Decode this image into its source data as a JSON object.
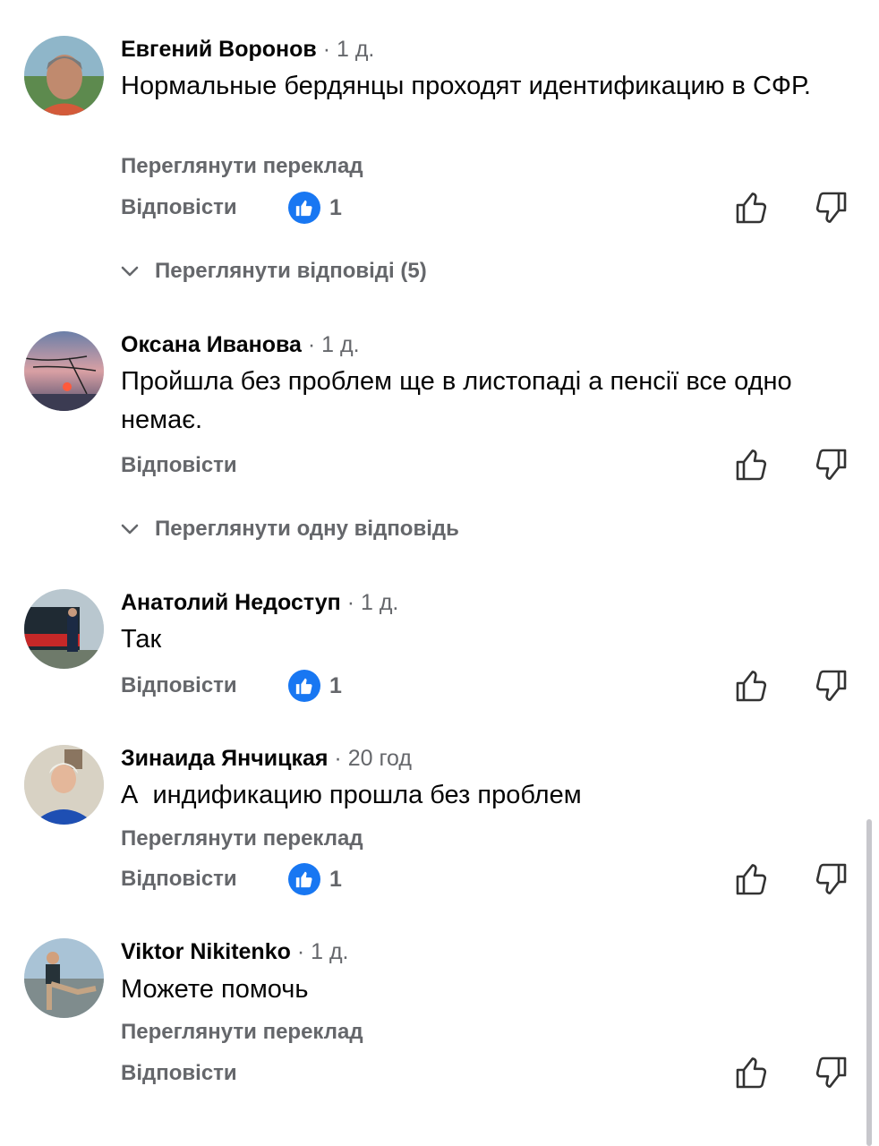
{
  "comments": [
    {
      "name": "Евгений Воронов",
      "time": "1 д.",
      "text": "Нормальные бердянцы проходят идентификацию в СФР.",
      "translate": "Переглянути переклад",
      "reply": "Відповісти",
      "reactions": "1",
      "replies": "Переглянути відповіді (5)"
    },
    {
      "name": "Оксана Иванова",
      "time": "1 д.",
      "text": "Пройшла без проблем ще в листопаді а пенсії все одно немає.",
      "reply": "Відповісти",
      "replies": "Переглянути одну відповідь"
    },
    {
      "name": "Анатолий Недоступ",
      "time": "1 д.",
      "text": "Так",
      "reply": "Відповісти",
      "reactions": "1"
    },
    {
      "name": "Зинаида Янчицкая",
      "time": "20 год",
      "text": "А  индификацию прошла без проблем",
      "translate": "Переглянути переклад",
      "reply": "Відповісти",
      "reactions": "1"
    },
    {
      "name": "Viktor Nikitenko",
      "time": "1 д.",
      "text": "Можете помочь",
      "translate": "Переглянути переклад",
      "reply": "Відповісти"
    }
  ],
  "separator": "·",
  "icons": {
    "like": "thumbs-up-icon",
    "dislike": "thumbs-down-icon",
    "reaction": "like-reaction-icon",
    "expand": "chevron-down-icon"
  },
  "colors": {
    "accent": "#1877f2",
    "secondary_text": "#65676b",
    "primary_text": "#050505"
  }
}
